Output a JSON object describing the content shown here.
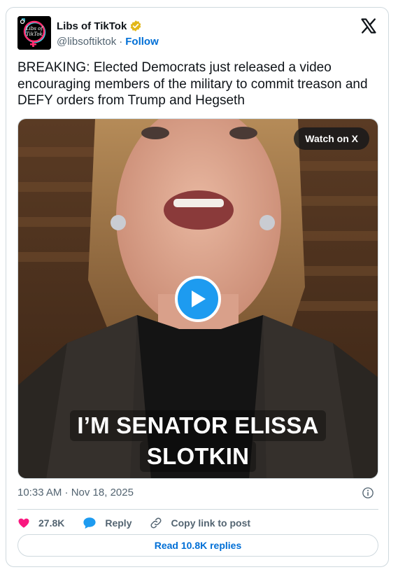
{
  "author": {
    "display_name": "Libs of TikTok",
    "handle": "@libsoftiktok",
    "separator": "·",
    "follow_label": "Follow",
    "avatar_text_line1": "Libs of",
    "avatar_text_line2": "TikTok"
  },
  "tweet": {
    "text": "BREAKING: Elected Democrats just released a video encouraging members of the military to commit treason and DEFY orders from Trump and Hegseth",
    "timestamp": "10:33 AM · Nov 18, 2025"
  },
  "media": {
    "watch_label": "Watch on X",
    "caption_line1": "I’M SENATOR ELISSA",
    "caption_line2": "SLOTKIN"
  },
  "actions": {
    "likes_count": "27.8K",
    "reply_label": "Reply",
    "copy_link_label": "Copy link to post"
  },
  "read_replies_label": "Read 10.8K replies",
  "colors": {
    "accent": "#1d9bf0",
    "link": "#006fd6",
    "like": "#f91880",
    "verified": "#e2b719",
    "border": "#cfd9de",
    "muted": "#536471"
  },
  "icons": [
    "verified-badge-icon",
    "x-logo-icon",
    "play-icon",
    "info-icon",
    "heart-icon",
    "reply-bubble-icon",
    "link-icon"
  ]
}
